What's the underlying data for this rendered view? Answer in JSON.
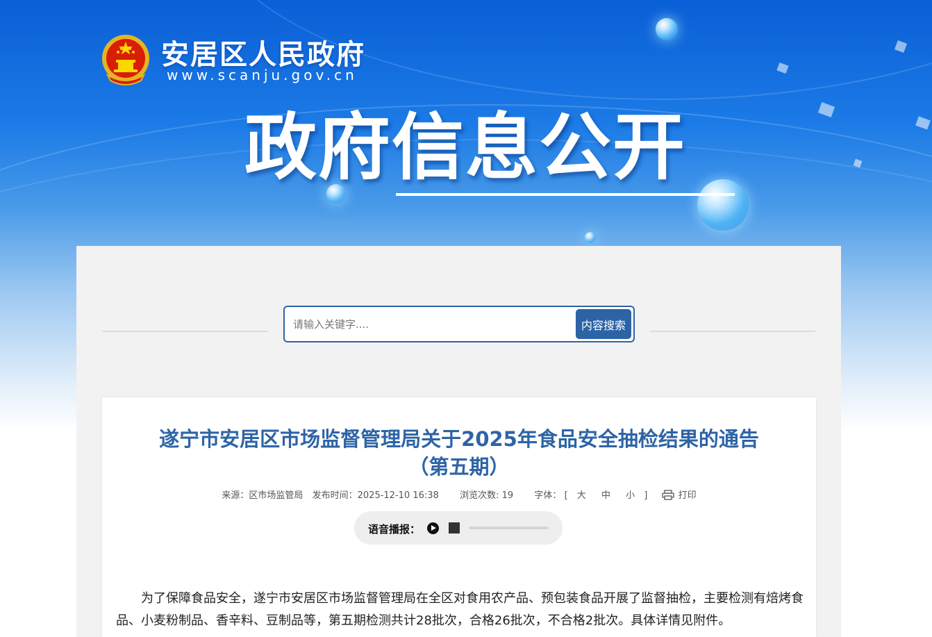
{
  "header": {
    "site_name": "安居区人民政府",
    "site_url": "www.scanju.gov.cn",
    "logo_icon": "national-emblem-icon",
    "hero_title": "政府信息公开"
  },
  "search": {
    "placeholder": "请输入关键字....",
    "button_label": "内容搜索"
  },
  "article": {
    "title_line1": "遂宁市安居区市场监督管理局关于2025年食品安全抽检结果的通告",
    "title_line2": "（第五期）",
    "meta": {
      "source": "来源：区市场监管局",
      "publish_time": "发布时间：2025-12-10 16:38",
      "views": "浏览次数: 19",
      "font_label": "字体：",
      "bracket_open": "[",
      "size_large": "大",
      "size_medium": "中",
      "size_small": "小",
      "bracket_close": "]",
      "print_label": "打印"
    },
    "audio": {
      "label": "语音播报："
    },
    "body": "为了保障食品安全，遂宁市安居区市场监督管理局在全区对食用农产品、预包装食品开展了监督抽检，主要检测有焙烤食品、小麦粉制品、香辛料、豆制品等，第五期检测共计28批次，合格26批次，不合格2批次。具体详情见附件。"
  },
  "colors": {
    "title_blue": "#2d64a6",
    "button_blue": "#2c63a5",
    "banner_blue": "#0a5fd6"
  }
}
